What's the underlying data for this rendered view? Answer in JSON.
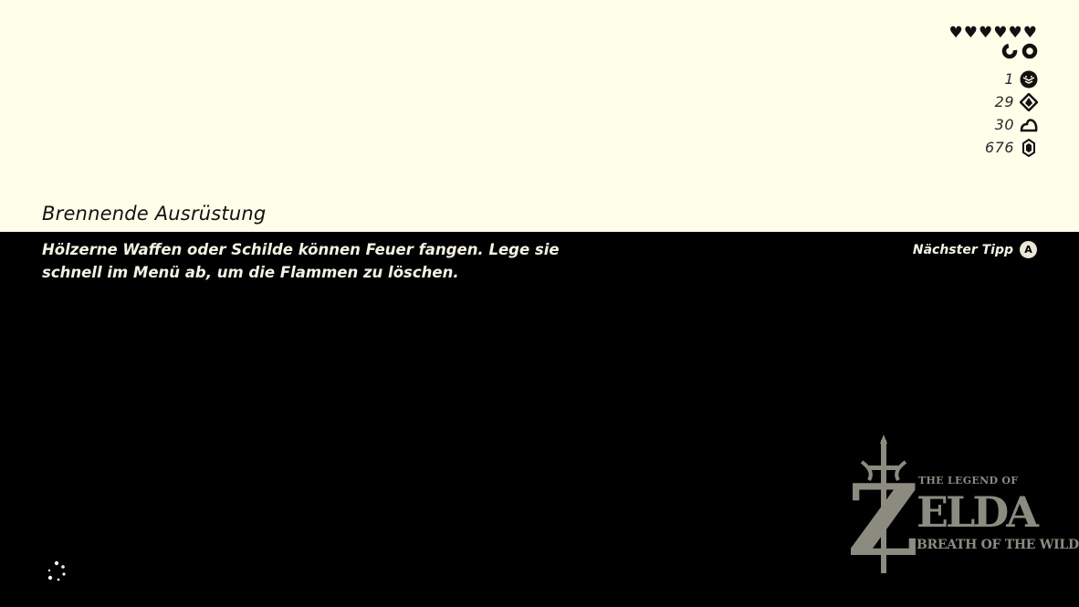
{
  "hud": {
    "hearts": [
      "♥",
      "♥",
      "♥",
      "♥",
      "♥",
      "♥"
    ],
    "heart_icon": "heart-icon",
    "stamina_icon": "stamina-wheel-icon",
    "resources": [
      {
        "count": "1",
        "icon": "korok-seed-icon"
      },
      {
        "count": "29",
        "icon": "spirit-orb-icon"
      },
      {
        "count": "30",
        "icon": "poe-icon"
      },
      {
        "count": "676",
        "icon": "rupee-icon"
      }
    ]
  },
  "tip": {
    "title": "Brennende Ausrüstung",
    "body": "Hölzerne Waffen oder Schilde können Feuer fangen. Lege sie schnell im Menü ab, um die Flammen zu löschen."
  },
  "next_tip": {
    "label": "Nächster Tipp",
    "button": "A"
  },
  "logo": {
    "line1": "THE LEGEND OF",
    "initial": "Z",
    "main": "ELDA",
    "line3": "BREATH OF THE WILD"
  },
  "colors": {
    "top_bg": "#fffee8",
    "bottom_bg": "#000000",
    "text_light": "#f4f2e2",
    "logo": "#8c8b7f"
  }
}
